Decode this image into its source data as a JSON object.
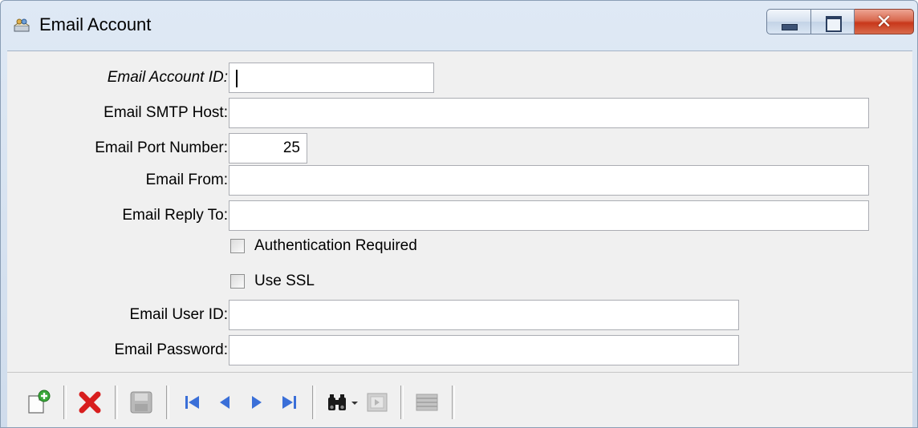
{
  "window": {
    "title": "Email Account",
    "caption_buttons": {
      "minimize": "minimize-icon",
      "maximize": "maximize-icon",
      "close": "close-icon"
    }
  },
  "form": {
    "account_id": {
      "label": "Email Account ID:",
      "value": ""
    },
    "smtp_host": {
      "label": "Email SMTP Host:",
      "value": ""
    },
    "port": {
      "label": "Email Port Number:",
      "value": "25"
    },
    "from": {
      "label": "Email From:",
      "value": ""
    },
    "reply_to": {
      "label": "Email Reply To:",
      "value": ""
    },
    "auth_required": {
      "label": "Authentication Required",
      "checked": false
    },
    "use_ssl": {
      "label": "Use SSL",
      "checked": false
    },
    "user_id": {
      "label": "Email User ID:",
      "value": ""
    },
    "password": {
      "label": "Email Password:",
      "value": ""
    }
  },
  "toolbar": {
    "buttons": [
      {
        "icon": "new-record-icon",
        "enabled": true
      },
      {
        "icon": "delete-icon",
        "enabled": true
      },
      {
        "icon": "save-icon",
        "enabled": false
      },
      {
        "icon": "first-record-icon",
        "enabled": true
      },
      {
        "icon": "previous-record-icon",
        "enabled": true
      },
      {
        "icon": "next-record-icon",
        "enabled": true
      },
      {
        "icon": "last-record-icon",
        "enabled": true
      },
      {
        "icon": "binoculars-icon",
        "enabled": true
      },
      {
        "icon": "dropdown-arrow-icon",
        "enabled": true
      },
      {
        "icon": "goto-record-icon",
        "enabled": false
      },
      {
        "icon": "grid-view-icon",
        "enabled": false
      }
    ]
  },
  "colors": {
    "titlebar": "#dfe9f5",
    "client_bg": "#f0f0f0",
    "delete_red": "#d81e1e",
    "nav_blue": "#3a6fd8",
    "close_red": "#c8371a"
  }
}
